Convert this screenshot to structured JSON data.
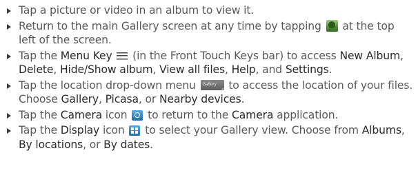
{
  "bullets": {
    "b1": {
      "text": "Tap a picture or video in an album to view it."
    },
    "b2": {
      "t1": "Return to the main Gallery screen at any time by tapping ",
      "t2": " at the top left of the screen.",
      "icon": "gallery-home-icon"
    },
    "b3": {
      "t1": "Tap the ",
      "k1": "Menu Key",
      "t2": " (in the Front Touch Keys bar) to access ",
      "k2": "New Album",
      "t3": ", ",
      "k3": "Delete",
      "t4": ", ",
      "k4": "Hide/Show album",
      "t5": ", ",
      "k5": "View all files",
      "t6": ", ",
      "k6": "Help",
      "t7": ", and ",
      "k7": "Settings",
      "t8": ".",
      "icon": "menu-icon"
    },
    "b4": {
      "t1": "Tap the location drop-down menu ",
      "dropdown_label": "Gallery",
      "t2": " to access the location of your files. Choose ",
      "k1": "Gallery",
      "t3": ", ",
      "k2": "Picasa",
      "t4": ", or ",
      "k3": "Nearby devices",
      "t5": ".",
      "icon": "dropdown-icon"
    },
    "b5": {
      "t1": "Tap the ",
      "k1": "Camera",
      "t2": " icon ",
      "t3": " to return to the ",
      "k2": "Camera",
      "t4": " application.",
      "icon": "camera-icon"
    },
    "b6": {
      "t1": "Tap the ",
      "k1": "Display",
      "t2": " icon ",
      "t3": " to select your Gallery view. Choose from ",
      "k2": "Albums",
      "t4": ", ",
      "k3": "By locations",
      "t5": ", or ",
      "k4": "By dates",
      "t6": ".",
      "icon": "display-icon"
    }
  },
  "colors": {
    "text": "#5a5a5a",
    "keyword": "#2b2b2b",
    "bullet": "#3a3a3a",
    "icon_blue": "#1f6fa8",
    "icon_green": "#4f8f34"
  }
}
